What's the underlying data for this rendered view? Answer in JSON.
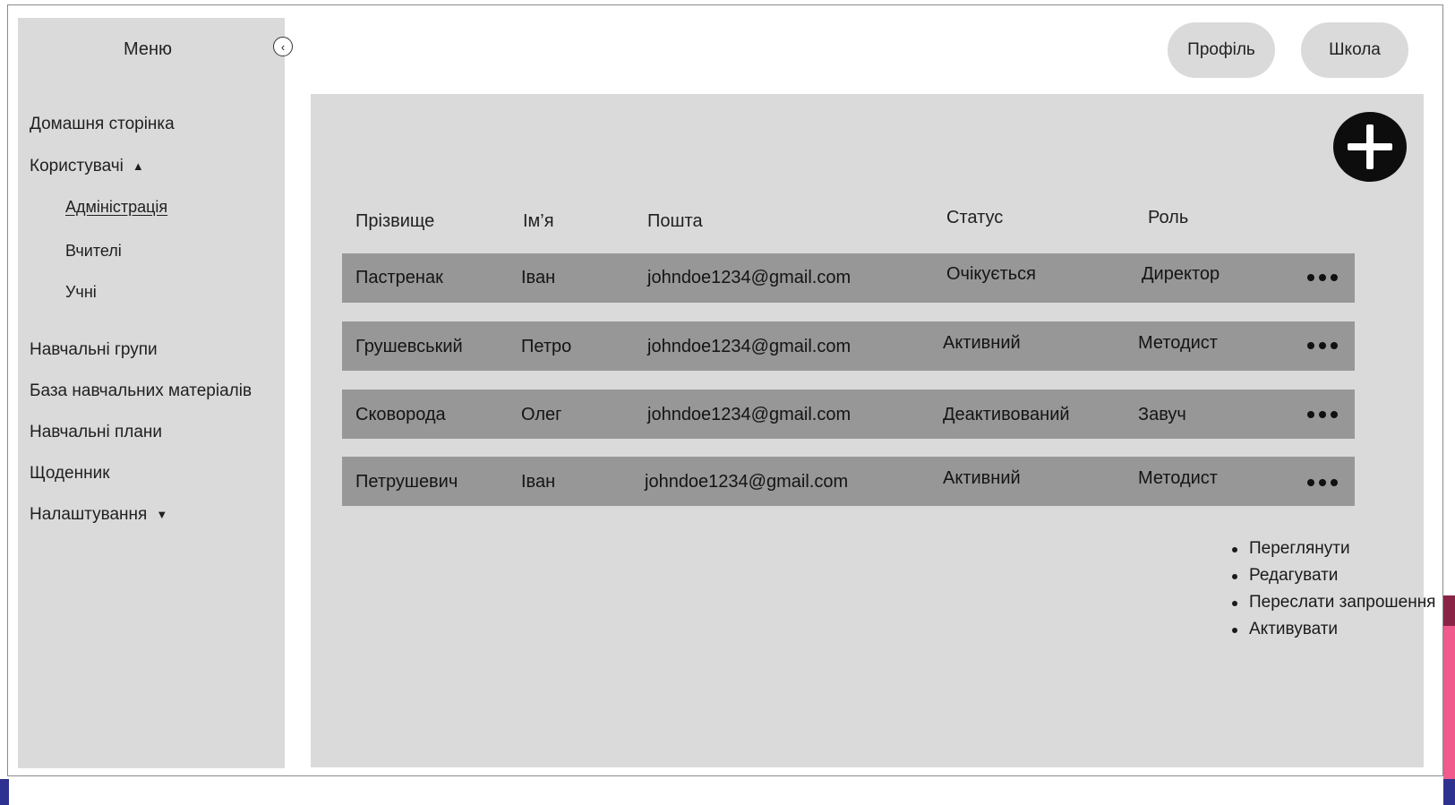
{
  "sidebar": {
    "title": "Меню",
    "collapse_icon": "chevron-left-icon",
    "items": [
      {
        "label": "Домашня сторінка"
      },
      {
        "label": "Користувачі",
        "expanded": true
      },
      {
        "label": "Навчальні групи"
      },
      {
        "label": "База навчальних матеріалів"
      },
      {
        "label": "Навчальні плани"
      },
      {
        "label": "Щоденник"
      },
      {
        "label": "Налаштування",
        "expanded": false
      }
    ],
    "sub_items": [
      {
        "label": "Адміністрація",
        "active": true
      },
      {
        "label": "Вчителі"
      },
      {
        "label": "Учні"
      }
    ]
  },
  "header": {
    "profile_label": "Профіль",
    "school_label": "Школа"
  },
  "table": {
    "columns": [
      "Прізвище",
      "Ім’я",
      "Пошта",
      "Статус",
      "Роль"
    ],
    "rows": [
      {
        "last_name": "Пастренак",
        "first_name": "Іван",
        "email": "johndoe1234@gmail.com",
        "status": "Очікується",
        "role": "Директор"
      },
      {
        "last_name": "Грушевський",
        "first_name": "Петро",
        "email": "johndoe1234@gmail.com",
        "status": "Активний",
        "role": "Методист"
      },
      {
        "last_name": "Сковорода",
        "first_name": "Олег",
        "email": "johndoe1234@gmail.com",
        "status": "Деактивований",
        "role": "Завуч"
      },
      {
        "last_name": "Петрушевич",
        "first_name": "Іван",
        "email": "johndoe1234@gmail.com",
        "status": "Активний",
        "role": "Методист"
      }
    ]
  },
  "context_menu": {
    "items": [
      "Переглянути",
      "Редагувати",
      "Переслати запрошення",
      "Активувати"
    ]
  },
  "colors": {
    "sidebar_bg": "#dadada",
    "panel_bg": "#dadada",
    "row_bg": "#979797",
    "add_button_bg": "#0d0d0d"
  }
}
